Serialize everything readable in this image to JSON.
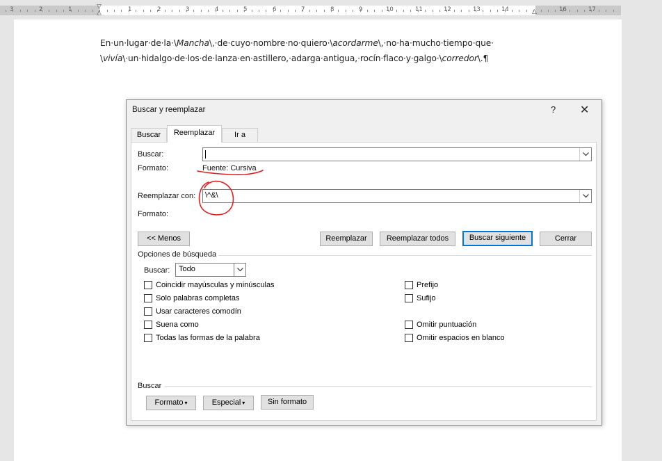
{
  "ruler": {
    "numbers": [
      "3",
      "2",
      "1",
      "1",
      "2",
      "3",
      "4",
      "5",
      "6",
      "7",
      "8",
      "9",
      "10",
      "11",
      "12",
      "13",
      "14",
      "16",
      "17"
    ]
  },
  "document": {
    "line1_a": "En·un·lugar·de·la·\\",
    "line1_b": "Mancha",
    "line1_c": "\\,·de·cuyo·nombre·no·quiero·\\",
    "line1_d": "acordarme",
    "line1_e": "\\,·no·ha·mucho·tiempo·que·",
    "line2_a": "\\",
    "line2_b": "vivía",
    "line2_c": "\\·un·hidalgo·de·los·de·lanza·en·astillero,·adarga·antigua,·rocín·flaco·y·galgo·\\",
    "line2_d": "corredor",
    "line2_e": "\\.¶"
  },
  "dialog": {
    "title": "Buscar y reemplazar",
    "help": "?",
    "close": "✕",
    "tabs": [
      "Buscar",
      "Reemplazar",
      "Ir a"
    ],
    "find_label": "Buscar:",
    "find_value": "",
    "find_format_label": "Formato:",
    "find_format_value": "Fuente: Cursiva",
    "replace_label": "Reemplazar con:",
    "replace_value": "\\^&\\",
    "replace_format_label": "Formato:",
    "buttons": {
      "less": "<< Menos",
      "replace": "Reemplazar",
      "replace_all": "Reemplazar todos",
      "find_next": "Buscar siguiente",
      "cancel": "Cerrar"
    },
    "options_title": "Opciones de búsqueda",
    "search_label": "Buscar:",
    "search_value": "Todo",
    "options_left": [
      "Coincidir mayúsculas y minúsculas",
      "Solo palabras completas",
      "Usar caracteres comodín",
      "Suena como",
      "Todas las formas de la palabra"
    ],
    "options_right": [
      "Prefijo",
      "Sufijo",
      "Omitir puntuación",
      "Omitir espacios en blanco"
    ],
    "bottom_group": "Buscar",
    "bottom_buttons": [
      "Formato",
      "Especial",
      "Sin formato"
    ],
    "dropdown_arrow": "▾"
  },
  "colors": {
    "annotation": "#e02020",
    "default_button_border": "#0078d7"
  }
}
